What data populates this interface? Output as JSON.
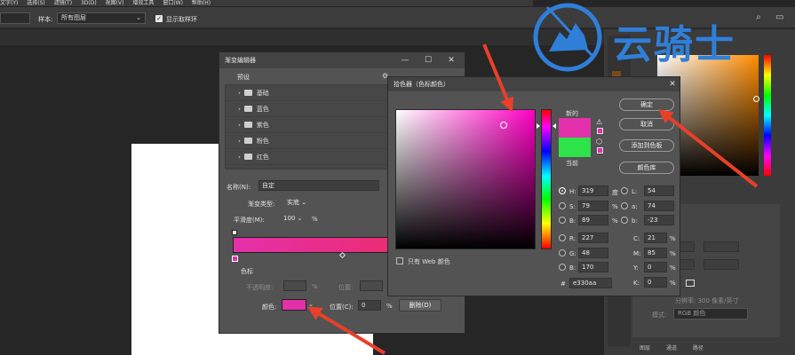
{
  "menubar": [
    "文字(Y)",
    "选择(S)",
    "滤镜(T)",
    "3D(D)",
    "视图(V)",
    "增效工具",
    "窗口(W)",
    "帮助(H)"
  ],
  "options_bar": {
    "sample_label": "样本:",
    "sample_value": "所有图层",
    "show_ring_label": "显示取样环"
  },
  "gradient_editor": {
    "title": "渐变编辑器",
    "presets_label": "预设",
    "preset_folders": [
      "基础",
      "蓝色",
      "紫色",
      "粉色",
      "红色"
    ],
    "name_label": "名称(N):",
    "name_value": "自定",
    "gradient_type_label": "渐变类型:",
    "gradient_type_value": "实底",
    "smoothness_label": "平滑度(M):",
    "smoothness_value": "100",
    "percent_sign": "%",
    "stops_label": "色标",
    "opacity_label": "不透明度:",
    "location_label_dim": "位置:",
    "color_label": "颜色:",
    "location_label": "位置(C):",
    "location_value": "0",
    "delete_button": "删除(D)",
    "start_color": "#e330aa",
    "end_color": "#ee2b5a"
  },
  "color_picker": {
    "title": "拾色器（色标颜色）",
    "new_label": "新的",
    "current_label": "当前",
    "new_color": "#e330aa",
    "current_color": "#2ee24a",
    "ok_button": "确定",
    "cancel_button": "取消",
    "add_swatch_button": "添加到色板",
    "color_library_button": "颜色库",
    "web_only_label": "只有 Web 颜色",
    "fields": {
      "H": {
        "label": "H:",
        "value": "319",
        "unit": "度"
      },
      "S": {
        "label": "S:",
        "value": "79",
        "unit": "%"
      },
      "B": {
        "label": "B:",
        "value": "89",
        "unit": "%"
      },
      "R": {
        "label": "R:",
        "value": "227"
      },
      "G": {
        "label": "G:",
        "value": "48"
      },
      "Bv": {
        "label": "B:",
        "value": "170"
      },
      "L": {
        "label": "L:",
        "value": "54"
      },
      "a": {
        "label": "a:",
        "value": "74"
      },
      "b": {
        "label": "b:",
        "value": "-23"
      },
      "C": {
        "label": "C:",
        "value": "21",
        "unit": "%"
      },
      "M": {
        "label": "M:",
        "value": "85",
        "unit": "%"
      },
      "Y": {
        "label": "Y:",
        "value": "0",
        "unit": "%"
      },
      "K": {
        "label": "K:",
        "value": "0",
        "unit": "%"
      }
    },
    "hash": "#",
    "hex_value": "e330aa"
  },
  "right_panel": {
    "tabs": [
      "图层",
      "通道",
      "路径"
    ],
    "resolution_text": "分辨率: 300 像素/英寸",
    "mode_label": "模式:",
    "mode_value": "RGB 颜色"
  },
  "watermark_text": "云骑士",
  "colors": {
    "arrow": "#e8402a",
    "accent_blue": "#2f7fd9"
  }
}
